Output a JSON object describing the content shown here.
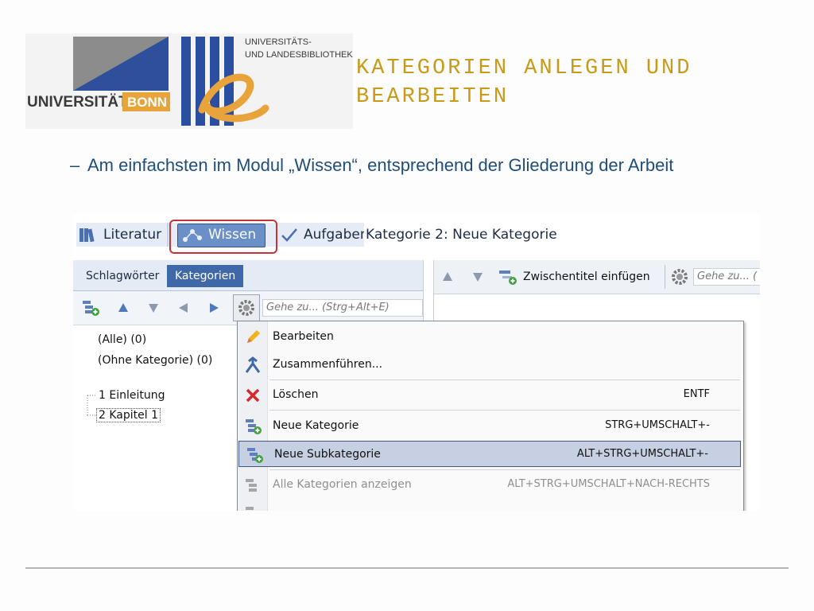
{
  "logo": {
    "uni_bonn": "UNIVERSITÄT",
    "bonn": "BONN",
    "ulb_line1": "UNIVERSITÄTS-",
    "ulb_line2": "UND LANDESBIBLIOTHEK"
  },
  "slide": {
    "title_line1": "KATEGORIEN ANLEGEN UND",
    "title_line2": "BEARBEITEN",
    "bullet_marker": "–",
    "bullet_text": "Am einfachsten im Modul „Wissen“, entsprechend der Gliederung der Arbeit"
  },
  "app": {
    "modules": {
      "literatur": "Literatur",
      "wissen": "Wissen",
      "aufgaben": "Aufgaben"
    },
    "window_title": "Kategorie 2:  Neue Kategorie",
    "left_tabs": {
      "schlagwoerter": "Schlagwörter",
      "kategorien": "Kategorien"
    },
    "left_search_placeholder": "Gehe zu... (Strg+Alt+E)",
    "tree": {
      "all": "(Alle) (0)",
      "none": "(Ohne Kategorie) (0)",
      "item1": "1 Einleitung",
      "item2": "2 Kapitel 1"
    },
    "right_toolbar": {
      "zwischentitel": "Zwischentitel einfügen",
      "search_placeholder": "Gehe zu... ("
    },
    "context_menu": [
      {
        "label": "Bearbeiten",
        "shortcut": ""
      },
      {
        "label": "Zusammenführen...",
        "shortcut": ""
      },
      {
        "label": "Löschen",
        "shortcut": "ENTF"
      },
      {
        "label": "Neue Kategorie",
        "shortcut": "STRG+UMSCHALT+-"
      },
      {
        "label": "Neue Subkategorie",
        "shortcut": "ALT+STRG+UMSCHALT+-"
      },
      {
        "label": "Alle Kategorien anzeigen",
        "shortcut": "ALT+STRG+UMSCHALT+NACH-RECHTS"
      }
    ]
  },
  "colors": {
    "title": "#c89a18",
    "bullet": "#1f4e79",
    "highlight_red": "#c4323a",
    "bonn_orange": "#e8a33a",
    "ulb_blue": "#2a4fa0"
  }
}
